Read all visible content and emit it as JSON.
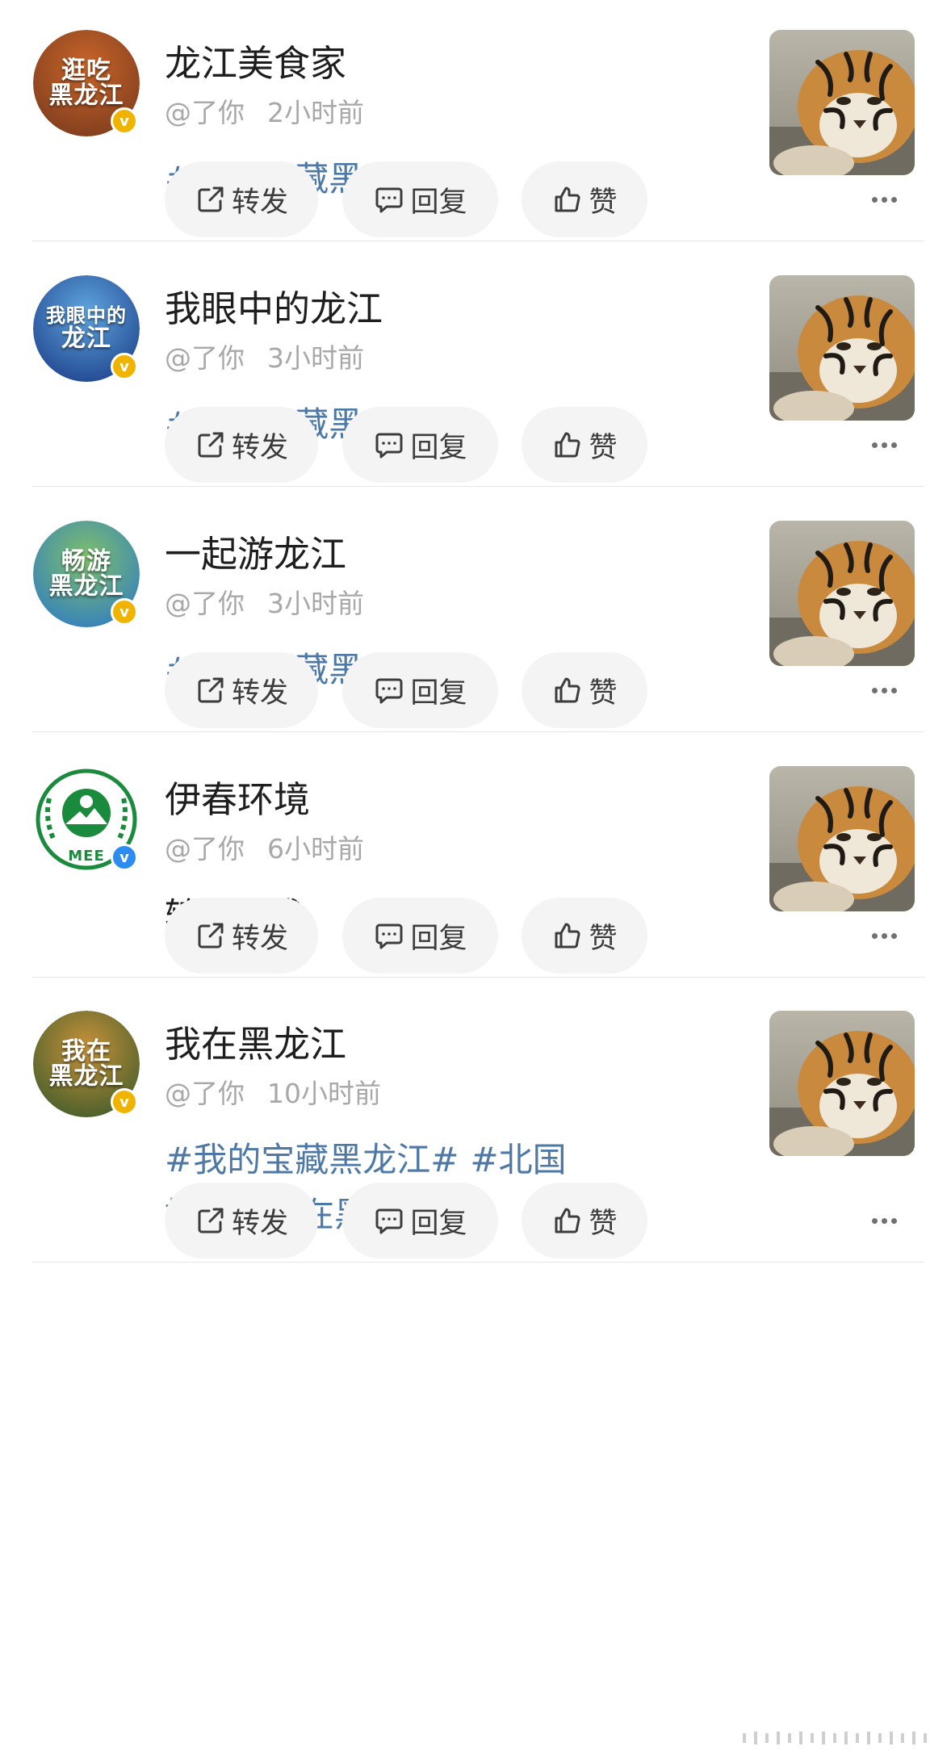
{
  "posts": [
    {
      "name": "龙江美食家",
      "handle": "@了你",
      "time": "2小时前",
      "avatar_text": [
        "逛吃",
        "黑龙江"
      ],
      "avatar_colors": [
        "#7a3b1c",
        "#c9652a"
      ],
      "badge_color": "#f0b400",
      "tags": [
        "#我的宝藏黑龙江#"
      ],
      "text": "",
      "actions": {
        "repost": "转发",
        "reply": "回复",
        "like": "赞"
      }
    },
    {
      "name": "我眼中的龙江",
      "handle": "@了你",
      "time": "3小时前",
      "avatar_text": [
        "我眼中的",
        "龙江"
      ],
      "avatar_colors": [
        "#1c3f8a",
        "#5fa6de"
      ],
      "badge_color": "#f0b400",
      "tags": [
        "#我的宝藏黑龙江#"
      ],
      "text": "",
      "actions": {
        "repost": "转发",
        "reply": "回复",
        "like": "赞"
      }
    },
    {
      "name": "一起游龙江",
      "handle": "@了你",
      "time": "3小时前",
      "avatar_text": [
        "畅游",
        "黑龙江"
      ],
      "avatar_colors": [
        "#2f7bc4",
        "#7fc06a"
      ],
      "badge_color": "#f0b400",
      "tags": [
        "#我的宝藏黑龙江#"
      ],
      "text": "",
      "actions": {
        "repost": "转发",
        "reply": "回复",
        "like": "赞"
      }
    },
    {
      "name": "伊春环境",
      "handle": "@了你",
      "time": "6小时前",
      "avatar_text": [
        "MEE"
      ],
      "avatar_colors": [
        "#ffffff",
        "#1a8a3c"
      ],
      "badge_color": "#2d8cf0",
      "tags": [],
      "text": "转发微博",
      "actions": {
        "repost": "转发",
        "reply": "回复",
        "like": "赞"
      }
    },
    {
      "name": "我在黑龙江",
      "handle": "@了你",
      "time": "10小时前",
      "avatar_text": [
        "我在",
        "黑龙江"
      ],
      "avatar_colors": [
        "#3c5a2a",
        "#c8923a"
      ],
      "badge_color": "#f0b400",
      "tags": [
        "#我的宝藏黑龙江#",
        "#北国好风光美在黑龙江#"
      ],
      "text": "",
      "actions": {
        "repost": "转发",
        "reply": "回复",
        "like": "赞"
      }
    }
  ],
  "icons": {
    "repost": "share-arrow-icon",
    "reply": "comment-bubble-icon",
    "like": "thumbs-up-icon",
    "more": "ellipsis-icon",
    "verified": "verified-badge-icon"
  },
  "colors": {
    "tag": "#4e79a7",
    "meta": "#a8a8a8",
    "pill_bg": "#f4f4f4"
  }
}
